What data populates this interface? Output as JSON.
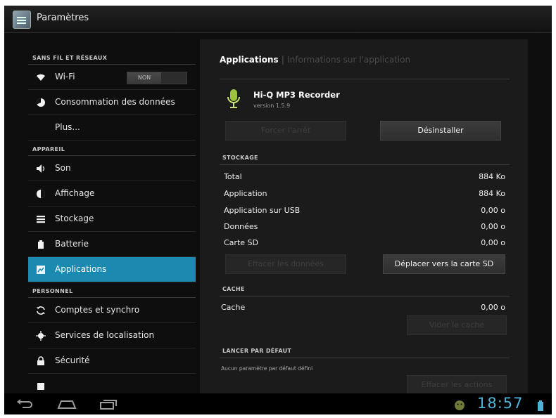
{
  "actionbar": {
    "title": "Paramètres",
    "icon": "settings-icon"
  },
  "sidebar": {
    "sections": [
      {
        "header": "SANS FIL ET RÉSEAUX",
        "items": [
          {
            "label": "Wi-Fi",
            "icon": "wifi-icon",
            "toggle": "NON"
          },
          {
            "label": "Consommation des données",
            "icon": "data-usage-icon"
          },
          {
            "label": "Plus...",
            "icon": ""
          }
        ]
      },
      {
        "header": "APPAREIL",
        "items": [
          {
            "label": "Son",
            "icon": "speaker-icon"
          },
          {
            "label": "Affichage",
            "icon": "brightness-icon"
          },
          {
            "label": "Stockage",
            "icon": "storage-icon"
          },
          {
            "label": "Batterie",
            "icon": "battery-icon"
          },
          {
            "label": "Applications",
            "icon": "apps-icon",
            "selected": true
          }
        ]
      },
      {
        "header": "PERSONNEL",
        "items": [
          {
            "label": "Comptes et synchro",
            "icon": "sync-icon"
          },
          {
            "label": "Services de localisation",
            "icon": "location-icon"
          },
          {
            "label": "Sécurité",
            "icon": "lock-icon"
          }
        ]
      }
    ]
  },
  "detail": {
    "breadcrumb": {
      "current": "Applications",
      "separator": "|",
      "next": "Informations sur l'application"
    },
    "app": {
      "name": "Hi-Q MP3 Recorder",
      "version": "version 1.5.9",
      "icon": "microphone-icon"
    },
    "buttons": {
      "force_stop": "Forcer l'arrêt",
      "uninstall": "Désinstaller",
      "clear_data": "Effacer les données",
      "move_sd": "Déplacer vers la carte SD",
      "clear_cache": "Vider le cache",
      "clear_defaults": "Effacer les actions"
    },
    "storage": {
      "header": "STOCKAGE",
      "rows": [
        {
          "label": "Total",
          "value": "884 Ko"
        },
        {
          "label": "Application",
          "value": "884 Ko"
        },
        {
          "label": "Application sur USB",
          "value": "0,00 o"
        },
        {
          "label": "Données",
          "value": "0,00 o"
        },
        {
          "label": "Carte SD",
          "value": "0,00 o"
        }
      ]
    },
    "cache": {
      "header": "CACHE",
      "label": "Cache",
      "value": "0,00 o"
    },
    "launch_default": {
      "header": "LANCER PAR DÉFAUT",
      "note": "Aucun paramètre par défaut défini"
    }
  },
  "navbar": {
    "back_icon": "back-icon",
    "home_icon": "home-icon",
    "recents_icon": "recent-apps-icon",
    "status_icon": "android-notification-icon",
    "time": "18:57",
    "battery_icon": "battery-status-icon"
  },
  "colors": {
    "selected": "#1a8ab0",
    "clock": "#4fb3d6",
    "background": "#0e0e0e"
  }
}
